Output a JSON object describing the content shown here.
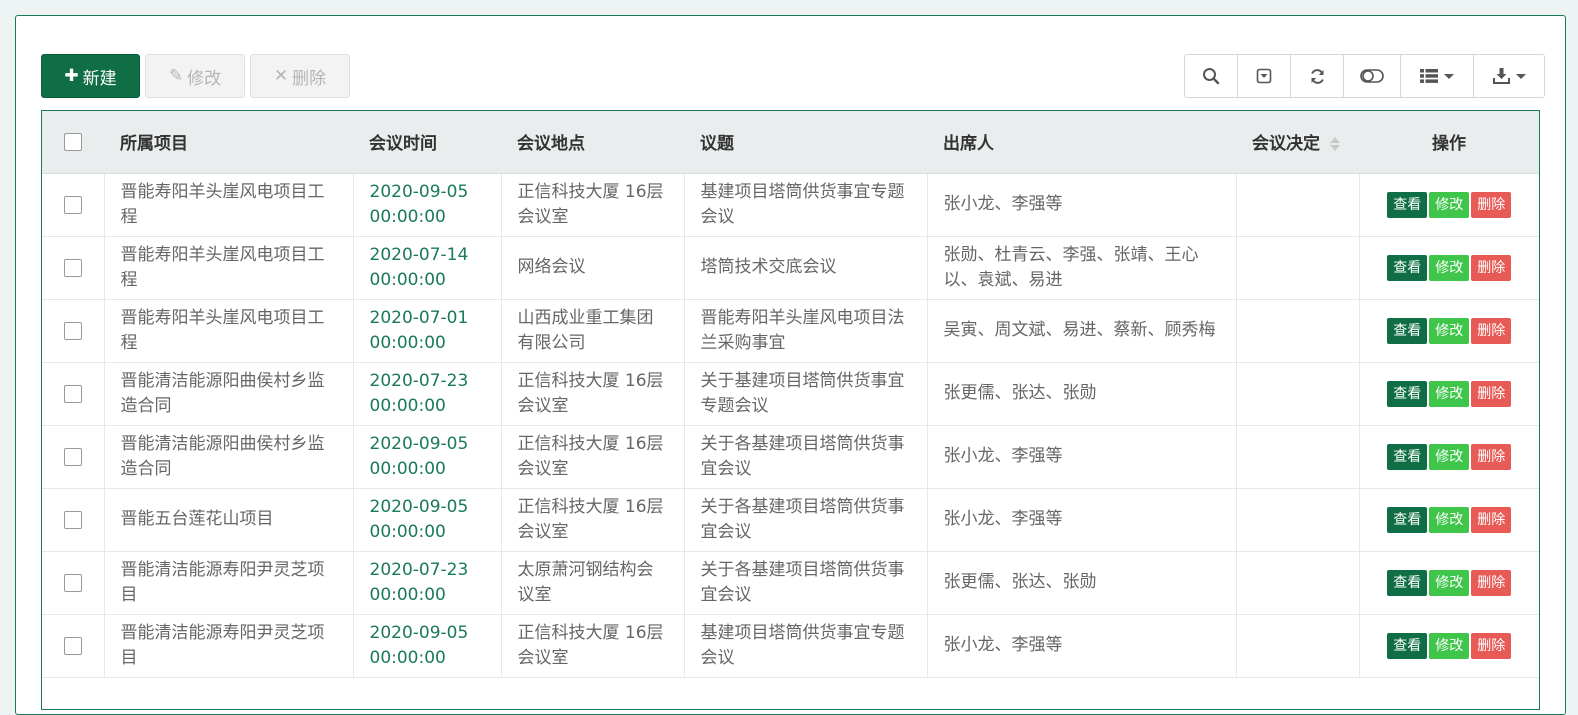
{
  "toolbar": {
    "new_label": "新建",
    "edit_label": "修改",
    "delete_label": "删除"
  },
  "icons": {
    "search": "search-icon",
    "toggle_pagination": "collapse-icon",
    "refresh": "refresh-icon",
    "toggle_view": "toggle-icon",
    "columns": "columns-icon",
    "export": "download-icon"
  },
  "colors": {
    "primary": "#0f6e45",
    "edit": "#3fc64a",
    "delete": "#e85a55"
  },
  "table": {
    "headers": [
      "所属项目",
      "会议时间",
      "会议地点",
      "议题",
      "出席人",
      "会议决定",
      "操作"
    ],
    "action_labels": {
      "view": "查看",
      "edit": "修改",
      "delete": "删除"
    },
    "rows": [
      {
        "project": "晋能寿阳羊头崖风电项目工程",
        "time": "2020-09-05 00:00:00",
        "place": "正信科技大厦 16层会议室",
        "topic": "基建项目塔筒供货事宜专题会议",
        "attendees": "张小龙、李强等",
        "decision": ""
      },
      {
        "project": "晋能寿阳羊头崖风电项目工程",
        "time": "2020-07-14 00:00:00",
        "place": "网络会议",
        "topic": "塔筒技术交底会议",
        "attendees": "张勋、杜青云、李强、张靖、王心以、袁斌、易进",
        "decision": ""
      },
      {
        "project": "晋能寿阳羊头崖风电项目工程",
        "time": "2020-07-01 00:00:00",
        "place": "山西成业重工集团有限公司",
        "topic": "晋能寿阳羊头崖风电项目法兰采购事宜",
        "attendees": "吴寅、周文斌、易进、蔡新、顾秀梅",
        "decision": ""
      },
      {
        "project": "晋能清洁能源阳曲侯村乡监造合同",
        "time": "2020-07-23 00:00:00",
        "place": "正信科技大厦 16层会议室",
        "topic": "关于基建项目塔筒供货事宜专题会议",
        "attendees": "张更儒、张达、张勋",
        "decision": ""
      },
      {
        "project": "晋能清洁能源阳曲侯村乡监造合同",
        "time": "2020-09-05 00:00:00",
        "place": "正信科技大厦 16层会议室",
        "topic": "关于各基建项目塔筒供货事宜会议",
        "attendees": "张小龙、李强等",
        "decision": ""
      },
      {
        "project": "晋能五台莲花山项目",
        "time": "2020-09-05 00:00:00",
        "place": "正信科技大厦 16层会议室",
        "topic": "关于各基建项目塔筒供货事宜会议",
        "attendees": "张小龙、李强等",
        "decision": ""
      },
      {
        "project": "晋能清洁能源寿阳尹灵芝项目",
        "time": "2020-07-23 00:00:00",
        "place": "太原萧河钢结构会议室",
        "topic": "关于各基建项目塔筒供货事宜会议",
        "attendees": "张更儒、张达、张勋",
        "decision": ""
      },
      {
        "project": "晋能清洁能源寿阳尹灵芝项目",
        "time": "2020-09-05 00:00:00",
        "place": "正信科技大厦 16层会议室",
        "topic": "基建项目塔筒供货事宜专题会议",
        "attendees": "张小龙、李强等",
        "decision": ""
      }
    ]
  }
}
